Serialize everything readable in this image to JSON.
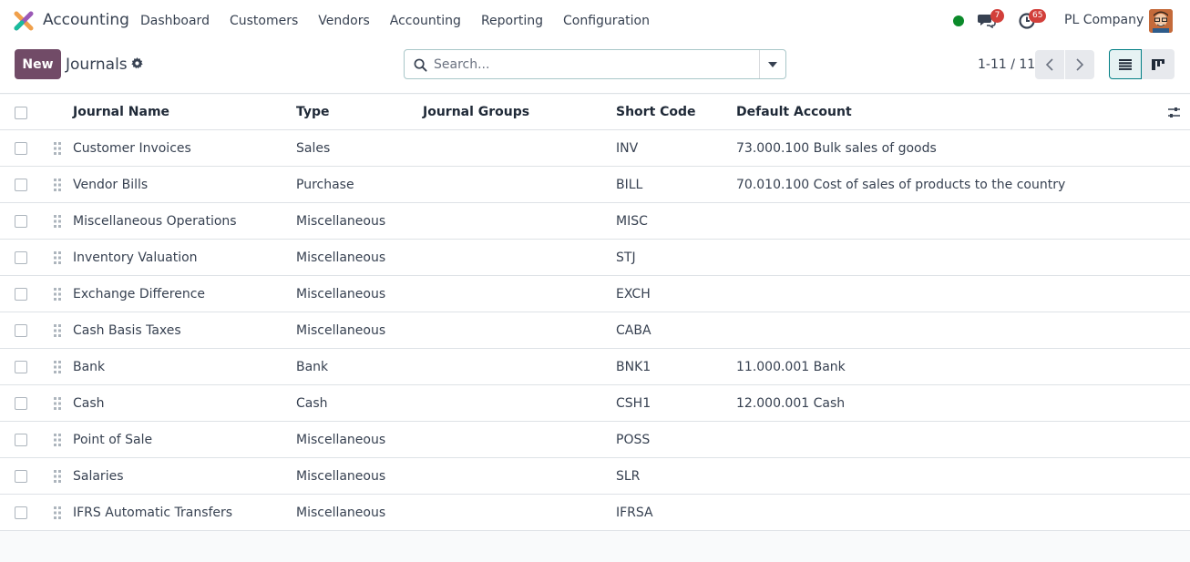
{
  "navbar": {
    "app_name": "Accounting",
    "menu": [
      "Dashboard",
      "Customers",
      "Vendors",
      "Accounting",
      "Reporting",
      "Configuration"
    ],
    "messages_count": "7",
    "activities_count": "65",
    "company": "PL Company",
    "status_color": "#0b8a2a"
  },
  "control": {
    "new_label": "New",
    "title": "Journals",
    "search_placeholder": "Search...",
    "pager": "1-11 / 11"
  },
  "colors": {
    "brand": "#714b67",
    "accent": "#017e84",
    "badge": "#d23f3a"
  },
  "table": {
    "columns": [
      "Journal Name",
      "Type",
      "Journal Groups",
      "Short Code",
      "Default Account"
    ],
    "rows": [
      {
        "name": "Customer Invoices",
        "type": "Sales",
        "groups": "",
        "code": "INV",
        "account": "73.000.100 Bulk sales of goods"
      },
      {
        "name": "Vendor Bills",
        "type": "Purchase",
        "groups": "",
        "code": "BILL",
        "account": "70.010.100 Cost of sales of products to the country"
      },
      {
        "name": "Miscellaneous Operations",
        "type": "Miscellaneous",
        "groups": "",
        "code": "MISC",
        "account": ""
      },
      {
        "name": "Inventory Valuation",
        "type": "Miscellaneous",
        "groups": "",
        "code": "STJ",
        "account": ""
      },
      {
        "name": "Exchange Difference",
        "type": "Miscellaneous",
        "groups": "",
        "code": "EXCH",
        "account": ""
      },
      {
        "name": "Cash Basis Taxes",
        "type": "Miscellaneous",
        "groups": "",
        "code": "CABA",
        "account": ""
      },
      {
        "name": "Bank",
        "type": "Bank",
        "groups": "",
        "code": "BNK1",
        "account": "11.000.001 Bank"
      },
      {
        "name": "Cash",
        "type": "Cash",
        "groups": "",
        "code": "CSH1",
        "account": "12.000.001 Cash"
      },
      {
        "name": "Point of Sale",
        "type": "Miscellaneous",
        "groups": "",
        "code": "POSS",
        "account": ""
      },
      {
        "name": "Salaries",
        "type": "Miscellaneous",
        "groups": "",
        "code": "SLR",
        "account": ""
      },
      {
        "name": "IFRS Automatic Transfers",
        "type": "Miscellaneous",
        "groups": "",
        "code": "IFRSA",
        "account": ""
      }
    ]
  }
}
